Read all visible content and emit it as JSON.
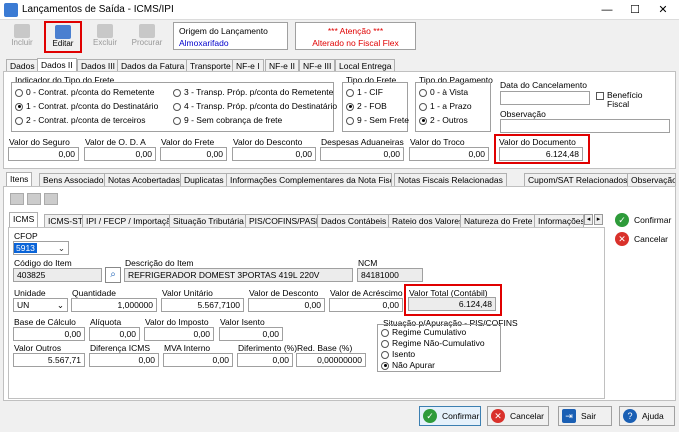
{
  "window": {
    "title": "Lançamentos de Saída - ICMS/IPI",
    "minimize": "—",
    "maximize": "☐",
    "close": "✕"
  },
  "toolbar": {
    "incluir": "Incluir",
    "editar": "Editar",
    "excluir": "Excluir",
    "procurar": "Procurar"
  },
  "origem": {
    "label": "Origem do Lançamento",
    "value": "Almoxarifado"
  },
  "atencao": {
    "title": "*** Atenção ***",
    "text": "Alterado no Fiscal Flex"
  },
  "top_tabs": [
    "Dados I",
    "Dados II",
    "Dados III",
    "Dados da Fatura",
    "Transporte",
    "NF-e I",
    "NF-e II",
    "NF-e III",
    "Local Entrega"
  ],
  "frete_indicador": {
    "label": "Indicador do Tipo do Frete",
    "options": [
      "0 - Contrat. p/conta do Remetente",
      "1 - Contrat. p/conta do Destinatário",
      "2 - Contrat. p/conta de terceiros",
      "3 - Transp. Próp. p/conta do Remetente",
      "4 - Transp. Próp. p/conta do Destinatário",
      "9 - Sem cobrança de frete"
    ]
  },
  "tipo_frete": {
    "label": "Tipo do Frete",
    "options": [
      "1 - CIF",
      "2 - FOB",
      "9 - Sem Frete"
    ]
  },
  "tipo_pagamento": {
    "label": "Tipo do Pagamento",
    "options": [
      "0 - à Vista",
      "1 - a Prazo",
      "2 - Outros"
    ]
  },
  "cancelamento": {
    "label": "Data do Cancelamento",
    "value": "",
    "beneficio": "Benefício Fiscal",
    "obs_label": "Observação",
    "obs_value": ""
  },
  "valores": {
    "seguro_label": "Valor do Seguro",
    "seguro": "0,00",
    "oda_label": "Valor de O. D. A",
    "oda": "0,00",
    "frete_label": "Valor do Frete",
    "frete": "0,00",
    "desconto_label": "Valor do Desconto",
    "desconto": "0,00",
    "despesas_label": "Despesas Aduaneiras",
    "despesas": "0,00",
    "troco_label": "Valor do Troco",
    "troco": "0,00",
    "documento_label": "Valor do Documento",
    "documento": "6.124,48"
  },
  "mid_tabs": [
    "Itens",
    "Bens Associados",
    "Notas Acobertadas",
    "Duplicatas",
    "Informações Complementares da Nota Fiscal",
    "Notas Fiscais Relacionadas",
    "Cupom/SAT Relacionados",
    "Observação d"
  ],
  "item_tabs": [
    "ICMS",
    "ICMS-ST",
    "IPI / FECP / Importação",
    "Situação Tributária",
    "PIS/COFINS/PASEP",
    "Dados Contábeis",
    "Rateio dos Valores",
    "Natureza do Frete",
    "Informações"
  ],
  "item": {
    "cfop_label": "CFOP",
    "cfop": "5913",
    "codigo_label": "Código do Item",
    "codigo": "403825",
    "descricao_label": "Descrição do Item",
    "descricao": "REFRIGERADOR DOMEST 3PORTAS 419L 220V",
    "ncm_label": "NCM",
    "ncm": "84181000",
    "unidade_label": "Unidade",
    "unidade": "UN",
    "quantidade_label": "Quantidade",
    "quantidade": "1,000000",
    "unitario_label": "Valor Unitário",
    "unitario": "5.567,7100",
    "vdesconto_label": "Valor de Desconto",
    "vdesconto": "0,00",
    "acrescimo_label": "Valor de Acréscimo",
    "acrescimo": "0,00",
    "total_label": "Valor Total (Contábil)",
    "total": "6.124,48",
    "base_label": "Base de Cálculo",
    "base": "0,00",
    "aliquota_label": "Alíquota",
    "aliquota": "0,00",
    "imposto_label": "Valor do Imposto",
    "imposto": "0,00",
    "isento_label": "Valor Isento",
    "isento": "0,00",
    "outros_label": "Valor Outros",
    "outros": "5.567,71",
    "difer_icms_label": "Diferença ICMS",
    "difer_icms": "0,00",
    "mva_label": "MVA Interno",
    "mva": "0,00",
    "diferimento_label": "Diferimento (%)",
    "diferimento": "0,00",
    "redbase_label": "Red. Base (%)",
    "redbase": "0,00000000"
  },
  "pis_cofins": {
    "label": "Situação p/Apuração - PIS/COFINS",
    "options": [
      "Regime Cumulativo",
      "Regime Não-Cumulativo",
      "Isento",
      "Não Apurar"
    ]
  },
  "side_buttons": {
    "confirmar": "Confirmar",
    "cancelar": "Cancelar"
  },
  "bottom_buttons": {
    "confirmar": "Confirmar",
    "cancelar": "Cancelar",
    "sair": "Sair",
    "ajuda": "Ajuda"
  }
}
